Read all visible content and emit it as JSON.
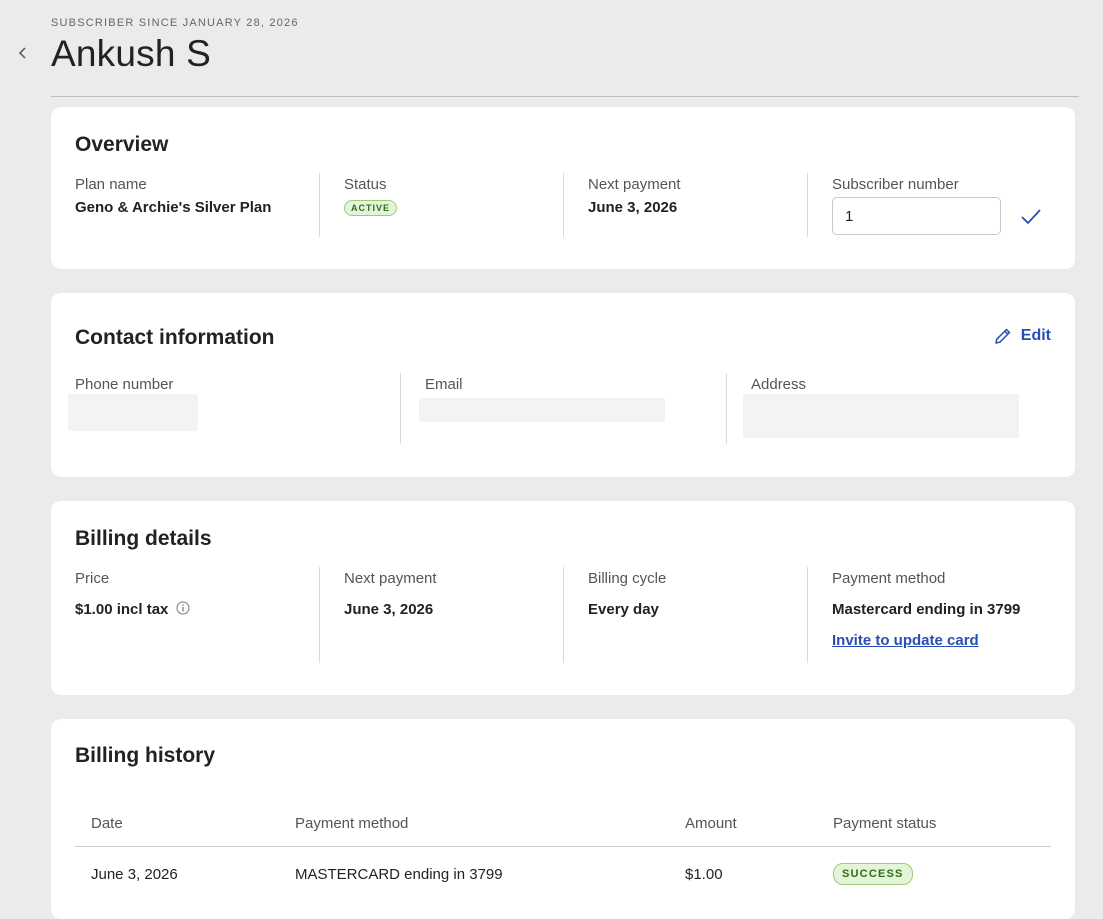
{
  "header": {
    "subscriber_since": "SUBSCRIBER SINCE JANUARY 28, 2026",
    "name": "Ankush S"
  },
  "overview": {
    "title": "Overview",
    "plan_name_label": "Plan name",
    "plan_name": "Geno & Archie's Silver Plan",
    "status_label": "Status",
    "status": "ACTIVE",
    "next_payment_label": "Next payment",
    "next_payment": "June 3, 2026",
    "subscriber_number_label": "Subscriber number",
    "subscriber_number": "1"
  },
  "contact": {
    "title": "Contact information",
    "edit_label": "Edit",
    "phone_label": "Phone number",
    "email_label": "Email",
    "address_label": "Address"
  },
  "billing": {
    "title": "Billing details",
    "price_label": "Price",
    "price": "$1.00 incl tax",
    "next_payment_label": "Next payment",
    "next_payment": "June 3, 2026",
    "cycle_label": "Billing cycle",
    "cycle": "Every day",
    "method_label": "Payment method",
    "method": "Mastercard ending in 3799",
    "invite_link": "Invite to update card"
  },
  "history": {
    "title": "Billing history",
    "columns": [
      "Date",
      "Payment method",
      "Amount",
      "Payment status"
    ],
    "rows": [
      {
        "date": "June 3, 2026",
        "method": "MASTERCARD ending in 3799",
        "amount": "$1.00",
        "status": "SUCCESS"
      }
    ]
  },
  "colors": {
    "accent": "#2a4db3",
    "success_bg": "#e4f4d8",
    "success_text": "#2f6d17",
    "page_bg": "#ebebec"
  },
  "icons": {
    "back": "chevron-left-icon",
    "confirm": "check-icon",
    "edit": "pencil-icon",
    "info": "info-icon"
  }
}
